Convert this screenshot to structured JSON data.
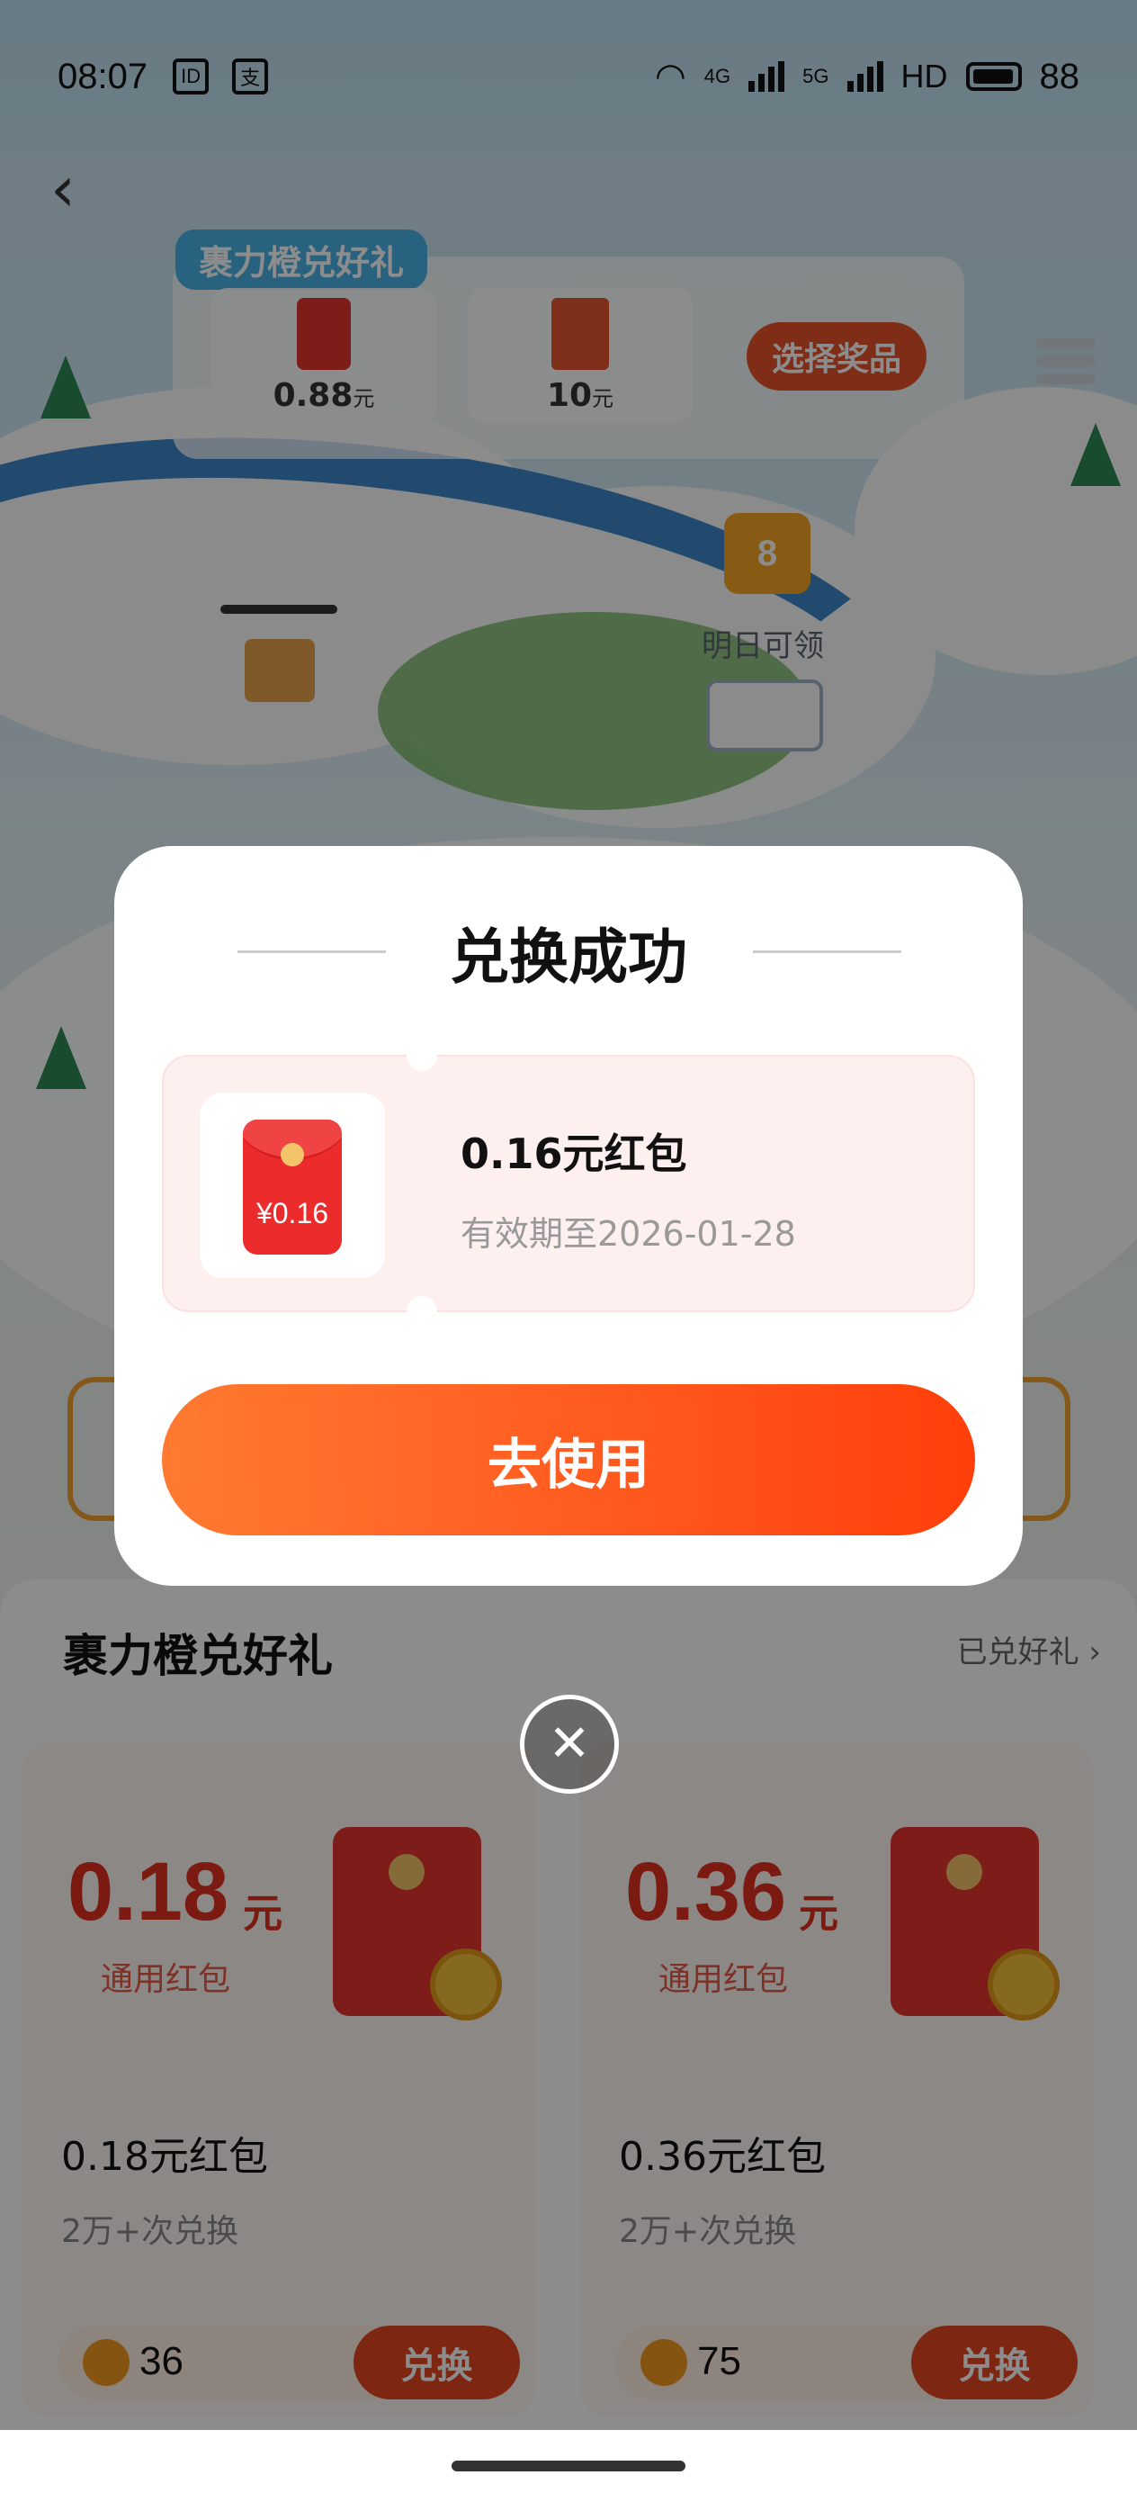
{
  "status_bar": {
    "time": "08:07",
    "app_icon_1": "ID",
    "app_icon_2": "支",
    "network_1": "4G",
    "network_2": "5G",
    "hd": "HD",
    "battery": "88"
  },
  "prize_panel": {
    "tag": "裹力橙兑好礼",
    "slot_1_value": "0.88",
    "slot_1_unit": "元",
    "slot_2_value": "10",
    "slot_2_unit": "元",
    "choose_label": "选择奖品"
  },
  "map": {
    "box_number": "8",
    "tomorrow_label": "明日可领"
  },
  "exchange_section": {
    "title": "裹力橙兑好礼",
    "redeemed_link": "已兑好礼 ›",
    "cards": [
      {
        "amount": "0.18",
        "unit": "元",
        "type": "通用红包",
        "name": "0.18元红包",
        "meta": "2万+次兑换",
        "cost": "36",
        "button": "兑换"
      },
      {
        "amount": "0.36",
        "unit": "元",
        "type": "通用红包",
        "name": "0.36元红包",
        "meta": "2万+次兑换",
        "cost": "75",
        "button": "兑换"
      }
    ]
  },
  "modal": {
    "title": "兑换成功",
    "packet_amount": "¥0.16",
    "reward_name": "0.16元红包",
    "expiry": "有效期至2026-01-28",
    "use_button": "去使用",
    "close_symbol": "✕"
  },
  "colors": {
    "brand_orange": "#ff5a1f",
    "red_packet": "#ec2c2c",
    "ticket_bg": "#fff0f0"
  }
}
